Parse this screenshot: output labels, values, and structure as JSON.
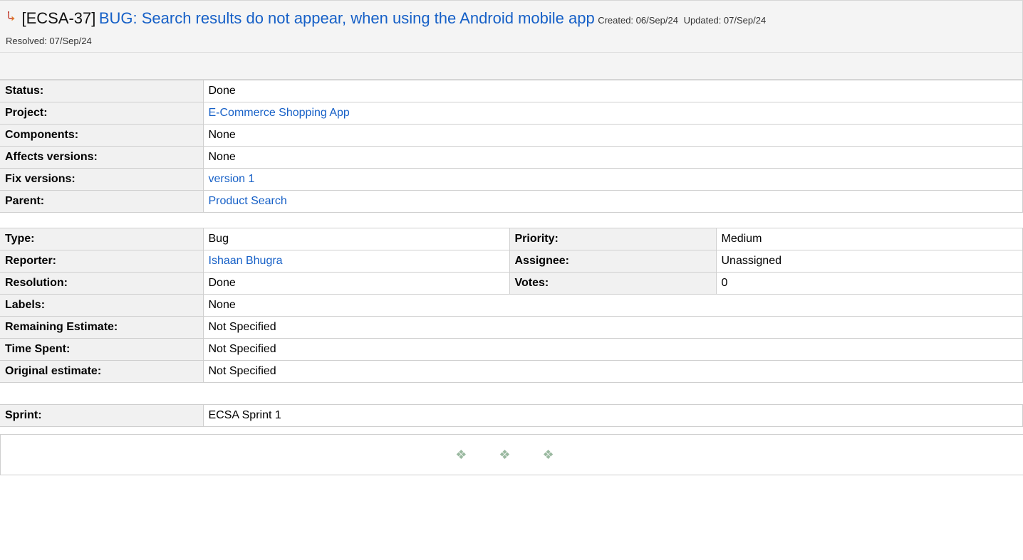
{
  "issue": {
    "key": "[ECSA-37]",
    "summary": "BUG: Search results do not appear, when using the Android mobile app",
    "created": "Created: 06/Sep/24",
    "updated": "Updated: 07/Sep/24",
    "resolved": "Resolved: 07/Sep/24",
    "type_icon": "bug-subtask-icon",
    "type_icon_color": "#c0392b"
  },
  "details": [
    {
      "label": "Status:",
      "value": "Done",
      "link": false
    },
    {
      "label": "Project:",
      "value": "E-Commerce Shopping App",
      "link": true
    },
    {
      "label": "Components:",
      "value": "None",
      "link": false
    },
    {
      "label": "Affects versions:",
      "value": "None",
      "link": false
    },
    {
      "label": "Fix versions:",
      "value": "version 1",
      "link": true
    },
    {
      "label": "Parent:",
      "value": "Product Search",
      "link": true
    }
  ],
  "people": {
    "type": {
      "label": "Type:",
      "value": "Bug"
    },
    "priority": {
      "label": "Priority:",
      "value": "Medium"
    },
    "reporter": {
      "label": "Reporter:",
      "value": "Ishaan Bhugra"
    },
    "assignee": {
      "label": "Assignee:",
      "value": "Unassigned"
    },
    "resolution": {
      "label": "Resolution:",
      "value": "Done"
    },
    "votes": {
      "label": "Votes:",
      "value": "0"
    },
    "labels": {
      "label": "Labels:",
      "value": "None"
    },
    "remaining": {
      "label": "Remaining Estimate:",
      "value": "Not Specified"
    },
    "time_spent": {
      "label": "Time Spent:",
      "value": "Not Specified"
    },
    "original": {
      "label": "Original estimate:",
      "value": "Not Specified"
    }
  },
  "sprint": {
    "label": "Sprint:",
    "value": "ECSA Sprint 1"
  },
  "footer": {
    "ornament": "❖ ❖ ❖"
  },
  "colors": {
    "link": "#1660c7",
    "label_bg": "#f1f1f1",
    "header_bg": "#f4f4f4"
  }
}
